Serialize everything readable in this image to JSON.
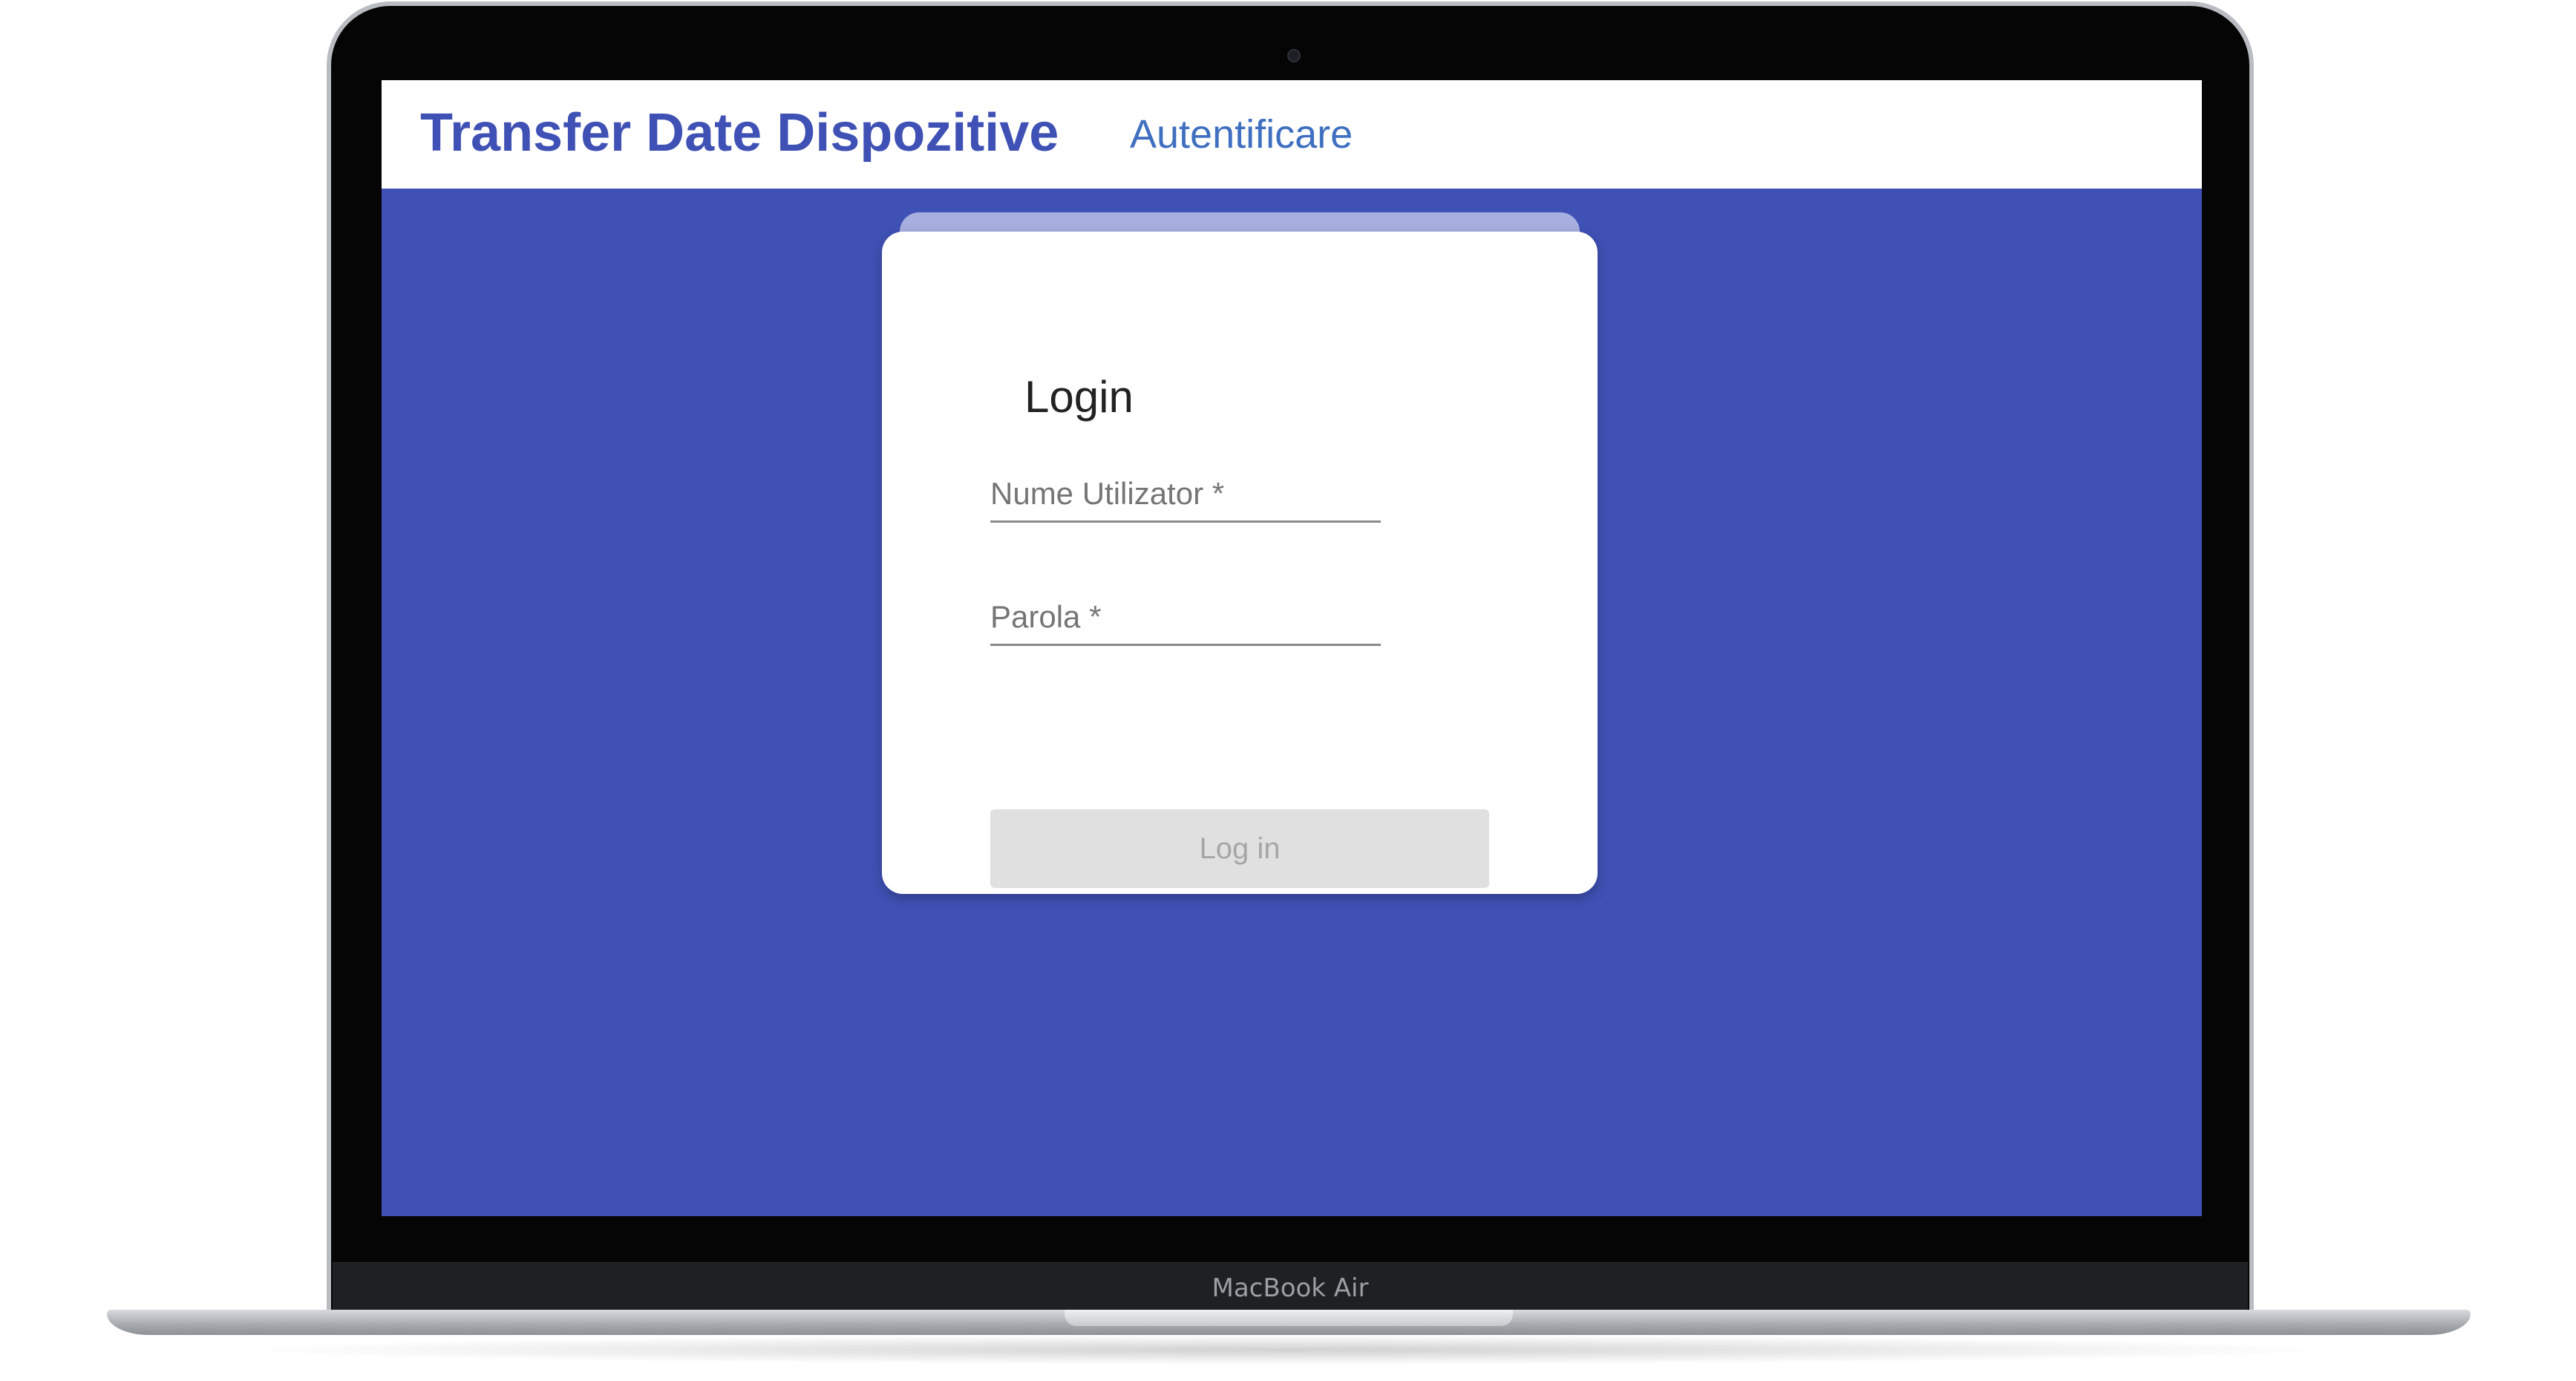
{
  "device": {
    "model_label": "MacBook Air"
  },
  "app": {
    "title": "Transfer Date Dispozitive",
    "nav": {
      "auth_link": "Autentificare"
    },
    "colors": {
      "primary": "#3f51b5",
      "header_bg": "#ffffff",
      "card_bg": "#ffffff",
      "card_tab": "#a7afe0",
      "button_disabled_bg": "#e0e0e0",
      "button_disabled_text": "#a6a6a6"
    }
  },
  "login_form": {
    "title": "Login",
    "username": {
      "value": "",
      "placeholder": "Nume Utilizator *"
    },
    "password": {
      "value": "",
      "placeholder": "Parola *"
    },
    "submit_label": "Log in",
    "submit_disabled": true
  }
}
